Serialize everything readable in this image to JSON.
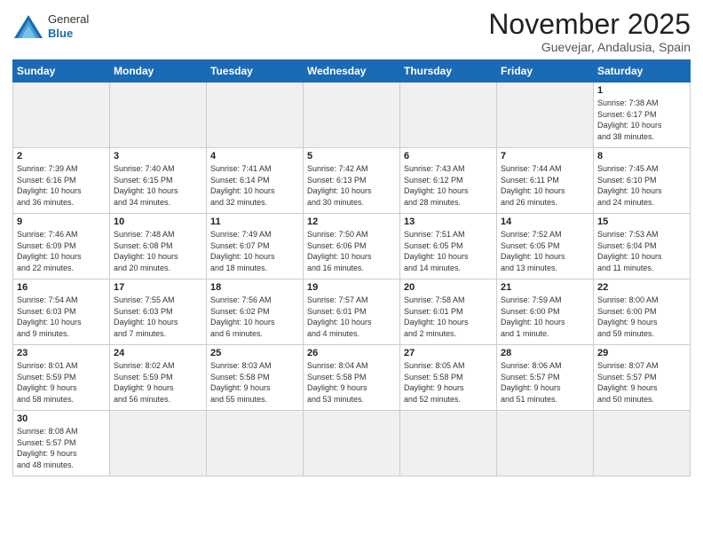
{
  "logo": {
    "general": "General",
    "blue": "Blue"
  },
  "title": "November 2025",
  "location": "Guevejar, Andalusia, Spain",
  "weekdays": [
    "Sunday",
    "Monday",
    "Tuesday",
    "Wednesday",
    "Thursday",
    "Friday",
    "Saturday"
  ],
  "weeks": [
    [
      {
        "day": "",
        "info": ""
      },
      {
        "day": "",
        "info": ""
      },
      {
        "day": "",
        "info": ""
      },
      {
        "day": "",
        "info": ""
      },
      {
        "day": "",
        "info": ""
      },
      {
        "day": "",
        "info": ""
      },
      {
        "day": "1",
        "info": "Sunrise: 7:38 AM\nSunset: 6:17 PM\nDaylight: 10 hours\nand 38 minutes."
      }
    ],
    [
      {
        "day": "2",
        "info": "Sunrise: 7:39 AM\nSunset: 6:16 PM\nDaylight: 10 hours\nand 36 minutes."
      },
      {
        "day": "3",
        "info": "Sunrise: 7:40 AM\nSunset: 6:15 PM\nDaylight: 10 hours\nand 34 minutes."
      },
      {
        "day": "4",
        "info": "Sunrise: 7:41 AM\nSunset: 6:14 PM\nDaylight: 10 hours\nand 32 minutes."
      },
      {
        "day": "5",
        "info": "Sunrise: 7:42 AM\nSunset: 6:13 PM\nDaylight: 10 hours\nand 30 minutes."
      },
      {
        "day": "6",
        "info": "Sunrise: 7:43 AM\nSunset: 6:12 PM\nDaylight: 10 hours\nand 28 minutes."
      },
      {
        "day": "7",
        "info": "Sunrise: 7:44 AM\nSunset: 6:11 PM\nDaylight: 10 hours\nand 26 minutes."
      },
      {
        "day": "8",
        "info": "Sunrise: 7:45 AM\nSunset: 6:10 PM\nDaylight: 10 hours\nand 24 minutes."
      }
    ],
    [
      {
        "day": "9",
        "info": "Sunrise: 7:46 AM\nSunset: 6:09 PM\nDaylight: 10 hours\nand 22 minutes."
      },
      {
        "day": "10",
        "info": "Sunrise: 7:48 AM\nSunset: 6:08 PM\nDaylight: 10 hours\nand 20 minutes."
      },
      {
        "day": "11",
        "info": "Sunrise: 7:49 AM\nSunset: 6:07 PM\nDaylight: 10 hours\nand 18 minutes."
      },
      {
        "day": "12",
        "info": "Sunrise: 7:50 AM\nSunset: 6:06 PM\nDaylight: 10 hours\nand 16 minutes."
      },
      {
        "day": "13",
        "info": "Sunrise: 7:51 AM\nSunset: 6:05 PM\nDaylight: 10 hours\nand 14 minutes."
      },
      {
        "day": "14",
        "info": "Sunrise: 7:52 AM\nSunset: 6:05 PM\nDaylight: 10 hours\nand 13 minutes."
      },
      {
        "day": "15",
        "info": "Sunrise: 7:53 AM\nSunset: 6:04 PM\nDaylight: 10 hours\nand 11 minutes."
      }
    ],
    [
      {
        "day": "16",
        "info": "Sunrise: 7:54 AM\nSunset: 6:03 PM\nDaylight: 10 hours\nand 9 minutes."
      },
      {
        "day": "17",
        "info": "Sunrise: 7:55 AM\nSunset: 6:03 PM\nDaylight: 10 hours\nand 7 minutes."
      },
      {
        "day": "18",
        "info": "Sunrise: 7:56 AM\nSunset: 6:02 PM\nDaylight: 10 hours\nand 6 minutes."
      },
      {
        "day": "19",
        "info": "Sunrise: 7:57 AM\nSunset: 6:01 PM\nDaylight: 10 hours\nand 4 minutes."
      },
      {
        "day": "20",
        "info": "Sunrise: 7:58 AM\nSunset: 6:01 PM\nDaylight: 10 hours\nand 2 minutes."
      },
      {
        "day": "21",
        "info": "Sunrise: 7:59 AM\nSunset: 6:00 PM\nDaylight: 10 hours\nand 1 minute."
      },
      {
        "day": "22",
        "info": "Sunrise: 8:00 AM\nSunset: 6:00 PM\nDaylight: 9 hours\nand 59 minutes."
      }
    ],
    [
      {
        "day": "23",
        "info": "Sunrise: 8:01 AM\nSunset: 5:59 PM\nDaylight: 9 hours\nand 58 minutes."
      },
      {
        "day": "24",
        "info": "Sunrise: 8:02 AM\nSunset: 5:59 PM\nDaylight: 9 hours\nand 56 minutes."
      },
      {
        "day": "25",
        "info": "Sunrise: 8:03 AM\nSunset: 5:58 PM\nDaylight: 9 hours\nand 55 minutes."
      },
      {
        "day": "26",
        "info": "Sunrise: 8:04 AM\nSunset: 5:58 PM\nDaylight: 9 hours\nand 53 minutes."
      },
      {
        "day": "27",
        "info": "Sunrise: 8:05 AM\nSunset: 5:58 PM\nDaylight: 9 hours\nand 52 minutes."
      },
      {
        "day": "28",
        "info": "Sunrise: 8:06 AM\nSunset: 5:57 PM\nDaylight: 9 hours\nand 51 minutes."
      },
      {
        "day": "29",
        "info": "Sunrise: 8:07 AM\nSunset: 5:57 PM\nDaylight: 9 hours\nand 50 minutes."
      }
    ],
    [
      {
        "day": "30",
        "info": "Sunrise: 8:08 AM\nSunset: 5:57 PM\nDaylight: 9 hours\nand 48 minutes."
      },
      {
        "day": "",
        "info": ""
      },
      {
        "day": "",
        "info": ""
      },
      {
        "day": "",
        "info": ""
      },
      {
        "day": "",
        "info": ""
      },
      {
        "day": "",
        "info": ""
      },
      {
        "day": "",
        "info": ""
      }
    ]
  ]
}
